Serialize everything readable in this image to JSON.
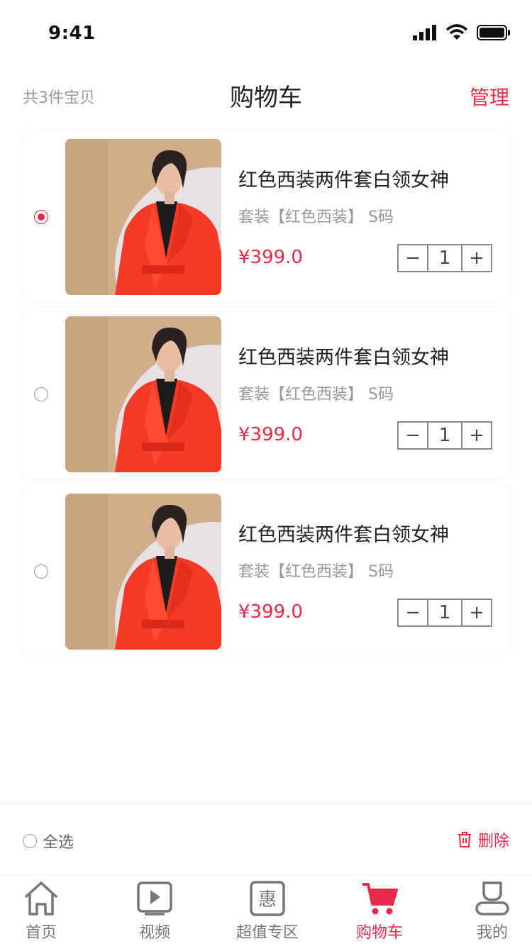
{
  "status_bar": {
    "time": "9:41"
  },
  "header": {
    "count_label": "共3件宝贝",
    "title": "购物车",
    "manage_label": "管理"
  },
  "cart": {
    "items": [
      {
        "title": "红色西装两件套白领女神",
        "spec": "套装【红色西装】 S码",
        "price": "¥399.0",
        "quantity": "1",
        "selected": true
      },
      {
        "title": "红色西装两件套白领女神",
        "spec": "套装【红色西装】 S码",
        "price": "¥399.0",
        "quantity": "1",
        "selected": false
      },
      {
        "title": "红色西装两件套白领女神",
        "spec": "套装【红色西装】 S码",
        "price": "¥399.0",
        "quantity": "1",
        "selected": false
      }
    ],
    "minus_label": "−",
    "plus_label": "+"
  },
  "action_bar": {
    "select_all_label": "全选",
    "delete_label": "删除"
  },
  "tab_bar": {
    "items": [
      {
        "label": "首页",
        "icon": "home-icon"
      },
      {
        "label": "视频",
        "icon": "video-icon"
      },
      {
        "label": "超值专区",
        "icon": "discount-icon"
      },
      {
        "label": "购物车",
        "icon": "cart-icon",
        "active": true
      },
      {
        "label": "我的",
        "icon": "user-icon"
      }
    ]
  },
  "colors": {
    "accent": "#e8294a",
    "muted": "#999999"
  }
}
